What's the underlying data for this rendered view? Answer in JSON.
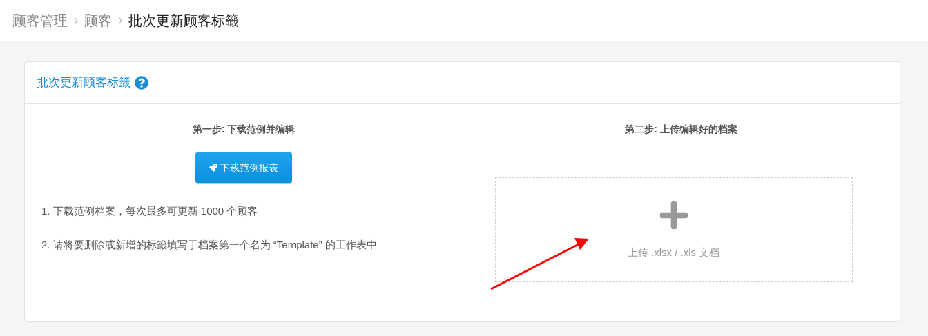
{
  "breadcrumb": [
    {
      "label": "顾客管理",
      "current": false
    },
    {
      "label": "顾客",
      "current": false
    },
    {
      "label": "批次更新顾客标籤",
      "current": true
    }
  ],
  "card": {
    "title": "批次更新顾客标籤",
    "step_1": {
      "title": "第一步: 下载范例并编辑",
      "button": "下载范例报表",
      "notes": [
        "1. 下载范例档案，每次最多可更新 1000 个顾客",
        "2. 请将要删除或新增的标籤填写于档案第一个名为 “Template” 的工作表中"
      ]
    },
    "step_2": {
      "title": "第二步: 上传编辑好的档案",
      "upload_hint": "上传 .xlsx / .xls 文档"
    }
  }
}
